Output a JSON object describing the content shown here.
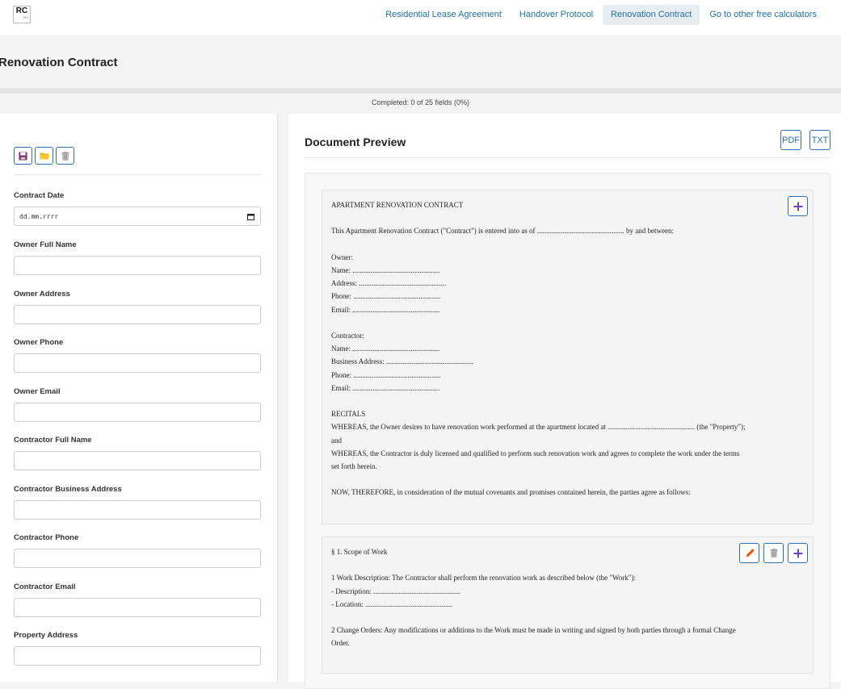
{
  "header": {
    "logo": {
      "main": "RC",
      "sub": ".RU"
    },
    "nav": [
      {
        "label": "Residential Lease Agreement",
        "active": false
      },
      {
        "label": "Handover Protocol",
        "active": false
      },
      {
        "label": "Renovation Contract",
        "active": true
      },
      {
        "label": "Go to other free calculators",
        "active": false
      }
    ]
  },
  "page": {
    "title": "Renovation Contract"
  },
  "progress": {
    "text": "Completed: 0 of 25 fields (0%)",
    "fraction": 0
  },
  "form": {
    "toolbar": [
      {
        "icon": "floppy-disk-icon"
      },
      {
        "icon": "folder-icon"
      },
      {
        "icon": "trash-icon"
      }
    ],
    "fields": [
      {
        "label": "Contract Date",
        "value": "dd.mm.rrrr",
        "type": "date"
      },
      {
        "label": "Owner Full Name",
        "value": ""
      },
      {
        "label": "Owner Address",
        "value": ""
      },
      {
        "label": "Owner Phone",
        "value": ""
      },
      {
        "label": "Owner Email",
        "value": ""
      },
      {
        "label": "Contractor Full Name",
        "value": ""
      },
      {
        "label": "Contractor Business Address",
        "value": ""
      },
      {
        "label": "Contractor Phone",
        "value": ""
      },
      {
        "label": "Contractor Email",
        "value": ""
      },
      {
        "label": "Property Address",
        "value": ""
      }
    ]
  },
  "preview": {
    "title": "Document Preview",
    "export": {
      "pdf": "PDF",
      "txt": "TXT"
    },
    "sections": [
      {
        "text": "APARTMENT RENOVATION CONTRACT\n\nThis Apartment Renovation Contract (\"Contract\") is entered into as of ................................................ by and between:\n\nOwner:\nName: ................................................\nAddress: ................................................\nPhone: ................................................\nEmail: ................................................\n\nContractor:\nName: ................................................\nBusiness Address: ................................................\nPhone: ................................................\nEmail: ................................................\n\nRECITALS\nWHEREAS, the Owner desires to have renovation work performed at the apartment located at ................................................ (the \"Property\");\nand\nWHEREAS, the Contractor is duly licensed and qualified to perform such renovation work and agrees to complete the work under the terms\nset forth herein.\n\nNOW, THEREFORE, in consideration of the mutual covenants and promises contained herein, the parties agree as follows:",
        "actions": [
          "plus-icon"
        ]
      },
      {
        "text": "§ 1. Scope of Work\n\n1 Work Description: The Contractor shall perform the renovation work as described below (the \"Work\"):\n- Description: ................................................\n- Location: ................................................\n\n2 Change Orders: Any modifications or additions to the Work must be made in writing and signed by both parties through a formal Change\nOrder.",
        "actions": [
          "pencil-icon",
          "trash-icon",
          "plus-icon"
        ]
      }
    ]
  },
  "colors": {
    "accent": "#2f6db3",
    "nav_text": "#1f6fa8",
    "plus": "#6f42c1",
    "pencil": "#e8590c",
    "folder": "#f0b400",
    "floppy": "#7b2d6e"
  }
}
